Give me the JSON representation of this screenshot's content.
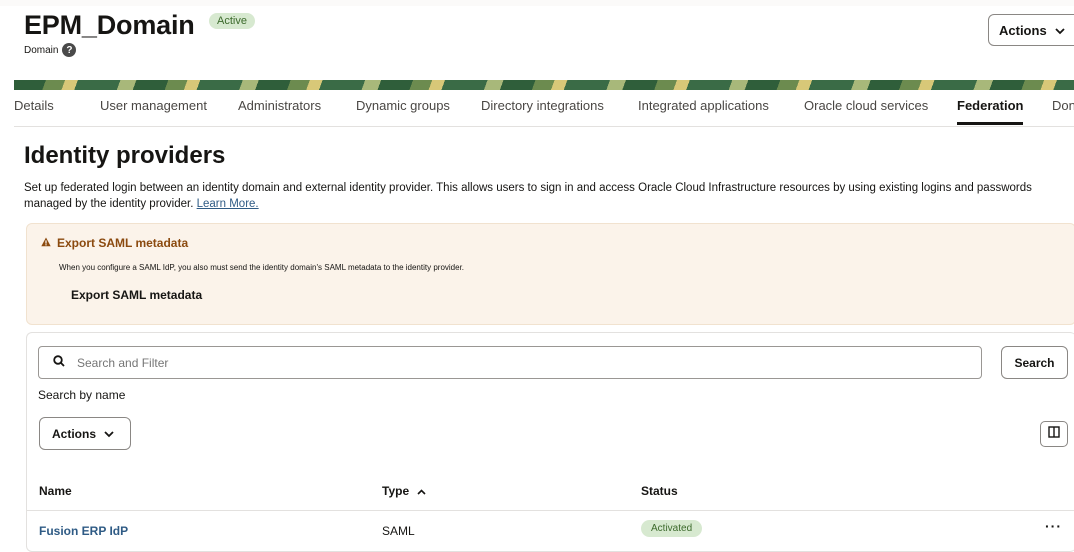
{
  "header": {
    "title": "EPM_Domain",
    "status_badge": "Active",
    "subtitle": "Domain",
    "actions_label": "Actions"
  },
  "tabs": [
    {
      "label": "Details"
    },
    {
      "label": "User management"
    },
    {
      "label": "Administrators"
    },
    {
      "label": "Dynamic groups"
    },
    {
      "label": "Directory integrations"
    },
    {
      "label": "Integrated applications"
    },
    {
      "label": "Oracle cloud services"
    },
    {
      "label": "Federation",
      "active": true
    },
    {
      "label": "Don"
    }
  ],
  "page": {
    "heading": "Identity providers",
    "description": "Set up federated login between an identity domain and external identity provider. This allows users to sign in and access Oracle Cloud Infrastructure resources by using existing logins and passwords managed by the identity provider.",
    "learn_more": "Learn More."
  },
  "warning": {
    "title": "Export SAML metadata",
    "body": "When you configure a SAML IdP, you also must send the identity domain's SAML metadata to the identity provider.",
    "button": "Export SAML metadata"
  },
  "search": {
    "placeholder": "Search and Filter",
    "button": "Search",
    "hint": "Search by name"
  },
  "toolbar": {
    "actions_label": "Actions"
  },
  "table": {
    "columns": [
      "Name",
      "Type",
      "Status"
    ],
    "rows": [
      {
        "name": "Fusion ERP IdP",
        "type": "SAML",
        "status": "Activated"
      }
    ]
  },
  "colors": {
    "link": "#2f5b85",
    "warning_title": "#8b4a0f",
    "status_green_bg": "#d7e9d0"
  }
}
